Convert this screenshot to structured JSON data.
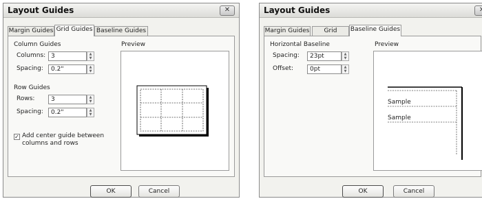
{
  "dialog1": {
    "title": "Layout Guides",
    "close_icon": "✕",
    "tabs": [
      {
        "label": "Margin Guides"
      },
      {
        "label": "Grid Guides"
      },
      {
        "label": "Baseline Guides"
      }
    ],
    "column_guides": {
      "heading": "Column Guides",
      "columns_label": "Columns:",
      "columns_value": "3",
      "spacing_label": "Spacing:",
      "spacing_value": "0.2\""
    },
    "row_guides": {
      "heading": "Row Guides",
      "rows_label": "Rows:",
      "rows_value": "3",
      "spacing_label": "Spacing:",
      "spacing_value": "0.2\""
    },
    "center_guide": {
      "checked": true,
      "line1": "Add center guide between",
      "line2": "columns and rows"
    },
    "preview_label": "Preview",
    "ok_label": "OK",
    "cancel_label": "Cancel"
  },
  "dialog2": {
    "title": "Layout Guides",
    "tabs": [
      {
        "label": "Margin Guides"
      },
      {
        "label": "Grid Guides"
      },
      {
        "label": "Baseline Guides"
      }
    ],
    "horizontal_baseline": {
      "heading": "Horizontal Baseline",
      "spacing_label": "Spacing:",
      "spacing_value": "23pt",
      "offset_label": "Offset:",
      "offset_value": "0pt"
    },
    "preview_label": "Preview",
    "sample1": "Sample",
    "sample2": "Sample",
    "ok_label": "OK",
    "cancel_label": "Cancel"
  }
}
